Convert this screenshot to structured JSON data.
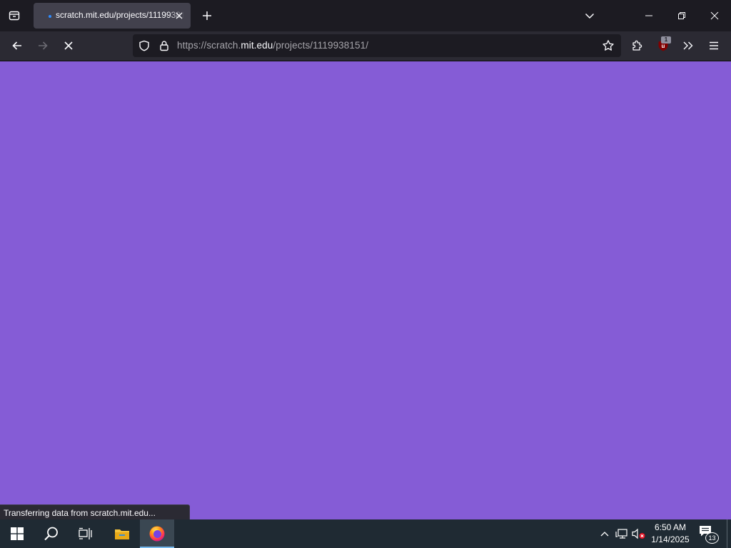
{
  "browser": {
    "tab": {
      "title": "scratch.mit.edu/projects/1119938151/",
      "favicon": "loading-dot-icon"
    },
    "url": {
      "prefix": "https://scratch.",
      "host": "mit.edu",
      "path": "/projects/1119938151/"
    },
    "extension_badge": "1",
    "status_text": "Transferring data from scratch.mit.edu...",
    "page_background": "#855cd6"
  },
  "taskbar": {
    "time": "6:50 AM",
    "date": "1/14/2025",
    "notification_count": "13"
  },
  "colors": {
    "tabstrip": "#1c1b22",
    "navbar": "#2b2a33",
    "active_tab": "#42414d",
    "taskbar": "#1f2a33",
    "scratch_purple": "#855cd6"
  }
}
